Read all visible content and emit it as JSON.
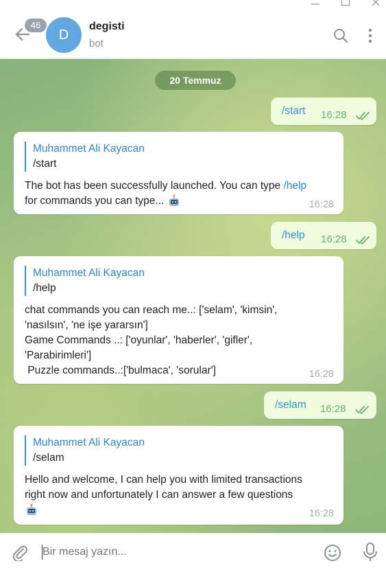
{
  "header": {
    "back_badge": "46",
    "avatar_letter": "D",
    "title": "degisti",
    "subtitle": "bot"
  },
  "chat": {
    "date": "20 Temmuz",
    "messages": [
      {
        "dir": "out",
        "text": "/start",
        "time": "16:28"
      },
      {
        "dir": "in",
        "reply_name": "Muhammet Ali Kayacan",
        "reply_text": "/start",
        "text_a": "The bot has been successfully launched. You can type ",
        "link": "/help",
        "text_b": "for commands you can type... ",
        "time": "16:28"
      },
      {
        "dir": "out",
        "text": "/help",
        "time": "16:28"
      },
      {
        "dir": "in",
        "reply_name": "Muhammet Ali Kayacan",
        "reply_text": "/help",
        "lines": [
          "chat commands you can reach me..: ['selam', 'kimsin',",
          "'nasılsın', 'ne işe yararsın']",
          "Game Commands ..: ['oyunlar', 'haberler', 'gifler',",
          "'Parabirimleri']",
          " Puzzle commands..:['bulmaca', 'sorular']"
        ],
        "time": "16:28"
      },
      {
        "dir": "out",
        "text": "/selam",
        "time": "16:28"
      },
      {
        "dir": "in",
        "reply_name": "Muhammet Ali Kayacan",
        "reply_text": "/selam",
        "lines": [
          "Hello and welcome, I can help you with limited transactions",
          "right now and unfortunately I can answer a few questions"
        ],
        "time": "16:28"
      }
    ]
  },
  "composer": {
    "placeholder": "Bir mesaj yazın..."
  },
  "icons": {
    "back": "arrow-left-icon",
    "search": "search-icon",
    "menu": "more-vertical-icon",
    "attach": "paperclip-icon",
    "emoji": "smile-icon",
    "mic": "microphone-icon",
    "read": "double-check-icon",
    "robot": "robot-emoji"
  },
  "colors": {
    "accent": "#3a90d2",
    "outgoing_bubble": "#effdde",
    "read_check": "#6ab06a"
  }
}
